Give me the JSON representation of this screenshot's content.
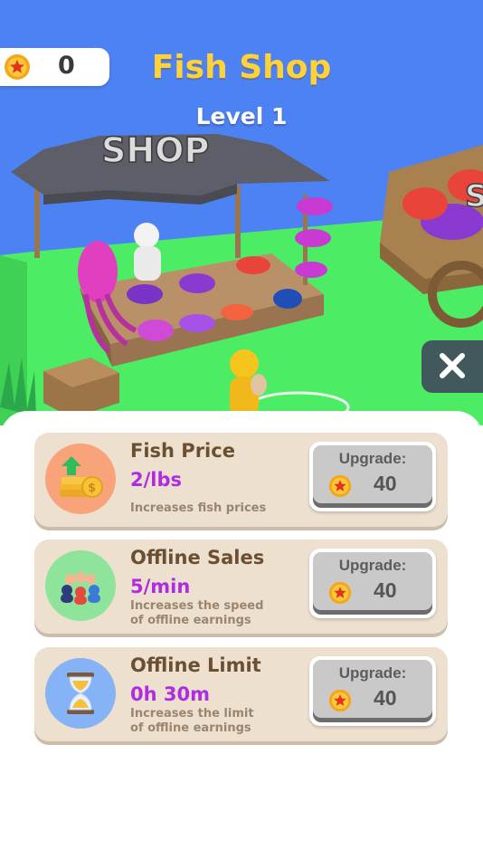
{
  "hud": {
    "coins": "0"
  },
  "header": {
    "title": "Fish Shop",
    "level": "Level 1"
  },
  "scene": {
    "sign": "SHOP"
  },
  "upgrades": [
    {
      "title": "Fish Price",
      "value": "2/lbs",
      "desc_line1": "Increases fish prices",
      "desc_line2": "",
      "button_label": "Upgrade:",
      "cost": "40",
      "icon": "money-up-icon",
      "icon_bg": "#f9a37a"
    },
    {
      "title": "Offline Sales",
      "value": "5/min",
      "desc_line1": "Increases the speed",
      "desc_line2": "of offline earnings",
      "button_label": "Upgrade:",
      "cost": "40",
      "icon": "customers-icon",
      "icon_bg": "#8ee49a"
    },
    {
      "title": "Offline Limit",
      "value": "0h 30m",
      "desc_line1": "Increases the limit",
      "desc_line2": "of offline earnings",
      "button_label": "Upgrade:",
      "cost": "40",
      "icon": "hourglass-icon",
      "icon_bg": "#86b3f5"
    }
  ],
  "colors": {
    "title": "#ffd23a",
    "value": "#b02ce0",
    "card_bg": "#ede0cf",
    "panel_bg": "#ffffff",
    "close_bg": "#41595c"
  }
}
